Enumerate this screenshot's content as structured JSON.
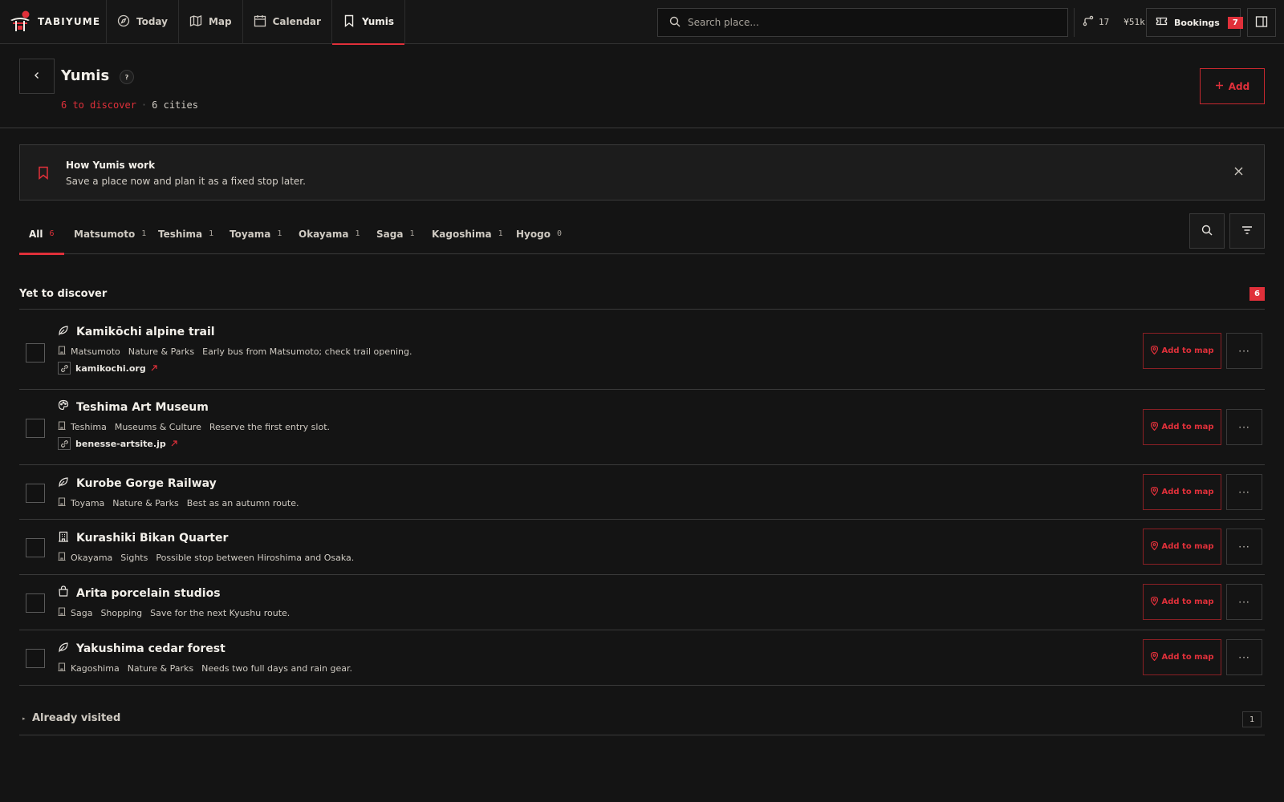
{
  "app": {
    "name": "TABIYUME"
  },
  "nav": [
    {
      "label": "Today",
      "icon": "compass-icon"
    },
    {
      "label": "Map",
      "icon": "map-icon"
    },
    {
      "label": "Calendar",
      "icon": "calendar-icon"
    },
    {
      "label": "Yumis",
      "icon": "bookmark-icon",
      "active": true
    }
  ],
  "search": {
    "placeholder": "Search place..."
  },
  "stats": {
    "count": "17",
    "budget": "¥51k"
  },
  "bookings": {
    "label": "Bookings",
    "count": "7"
  },
  "header": {
    "title": "Yumis",
    "help": "?",
    "to_discover": "6 to discover",
    "separator": "·",
    "cities": "6 cities",
    "add_label": "Add"
  },
  "info": {
    "title": "How Yumis work",
    "text": "Save a place now and plan it as a fixed stop later."
  },
  "tabs": [
    {
      "label": "All",
      "count": "6",
      "active": true
    },
    {
      "label": "Matsumoto",
      "count": "1"
    },
    {
      "label": "Teshima",
      "count": "1"
    },
    {
      "label": "Toyama",
      "count": "1"
    },
    {
      "label": "Okayama",
      "count": "1"
    },
    {
      "label": "Saga",
      "count": "1"
    },
    {
      "label": "Kagoshima",
      "count": "1"
    },
    {
      "label": "Hyogo",
      "count": "0"
    }
  ],
  "section": {
    "title": "Yet to discover",
    "count": "6"
  },
  "places": [
    {
      "name": "Kamikōchi alpine trail",
      "icon": "leaf-icon",
      "city": "Matsumoto",
      "category": "Nature & Parks",
      "note": "Early bus from Matsumoto; check trail opening.",
      "link": "kamikochi.org"
    },
    {
      "name": "Teshima Art Museum",
      "icon": "palette-icon",
      "city": "Teshima",
      "category": "Museums & Culture",
      "note": "Reserve the first entry slot.",
      "link": "benesse-artsite.jp"
    },
    {
      "name": "Kurobe Gorge Railway",
      "icon": "leaf-icon",
      "city": "Toyama",
      "category": "Nature & Parks",
      "note": "Best as an autumn route."
    },
    {
      "name": "Kurashiki Bikan Quarter",
      "icon": "building-icon",
      "city": "Okayama",
      "category": "Sights",
      "note": "Possible stop between Hiroshima and Osaka."
    },
    {
      "name": "Arita porcelain studios",
      "icon": "shopping-bag-icon",
      "city": "Saga",
      "category": "Shopping",
      "note": "Save for the next Kyushu route."
    },
    {
      "name": "Yakushima cedar forest",
      "icon": "leaf-icon",
      "city": "Kagoshima",
      "category": "Nature & Parks",
      "note": "Needs two full days and rain gear."
    }
  ],
  "row_actions": {
    "add_to_map": "Add to map",
    "more": "···"
  },
  "visited": {
    "title": "Already visited",
    "count": "1"
  },
  "colors": {
    "accent": "#e0303a",
    "background": "#141414",
    "border": "#3a3a3a"
  }
}
